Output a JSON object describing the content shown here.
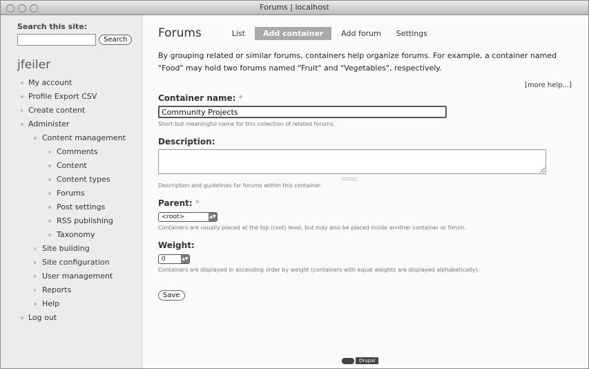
{
  "window": {
    "title": "Forums | localhost"
  },
  "sidebar": {
    "search_label": "Search this site:",
    "search_value": "",
    "search_button": "Search",
    "username": "jfeiler",
    "nav": [
      {
        "label": "My account",
        "level": 0,
        "collapsed": false
      },
      {
        "label": "Profile Export CSV",
        "level": 0,
        "collapsed": false
      },
      {
        "label": "Create content",
        "level": 0,
        "collapsed": true
      },
      {
        "label": "Administer",
        "level": 0,
        "collapsed": false
      },
      {
        "label": "Content management",
        "level": 1,
        "collapsed": false
      },
      {
        "label": "Comments",
        "level": 2,
        "collapsed": false
      },
      {
        "label": "Content",
        "level": 2,
        "collapsed": false
      },
      {
        "label": "Content types",
        "level": 2,
        "collapsed": false
      },
      {
        "label": "Forums",
        "level": 2,
        "collapsed": false
      },
      {
        "label": "Post settings",
        "level": 2,
        "collapsed": false
      },
      {
        "label": "RSS publishing",
        "level": 2,
        "collapsed": false
      },
      {
        "label": "Taxonomy",
        "level": 2,
        "collapsed": false
      },
      {
        "label": "Site building",
        "level": 1,
        "collapsed": true
      },
      {
        "label": "Site configuration",
        "level": 1,
        "collapsed": true
      },
      {
        "label": "User management",
        "level": 1,
        "collapsed": true
      },
      {
        "label": "Reports",
        "level": 1,
        "collapsed": true
      },
      {
        "label": "Help",
        "level": 1,
        "collapsed": false
      },
      {
        "label": "Log out",
        "level": 0,
        "collapsed": false
      }
    ]
  },
  "main": {
    "title": "Forums",
    "tabs": [
      {
        "label": "List",
        "active": false
      },
      {
        "label": "Add container",
        "active": true
      },
      {
        "label": "Add forum",
        "active": false
      },
      {
        "label": "Settings",
        "active": false
      }
    ],
    "intro": "By grouping related or similar forums, containers help organize forums. For example, a container named \"Food\" may hold two forums named \"Fruit\" and \"Vegetables\", respectively.",
    "more_help": "[more help...]",
    "container_name": {
      "label": "Container name:",
      "required_mark": "*",
      "value": "Community Projects",
      "description": "Short but meaningful name for this collection of related forums."
    },
    "description_field": {
      "label": "Description:",
      "value": "",
      "description": "Description and guidelines for forums within this container."
    },
    "parent": {
      "label": "Parent:",
      "required_mark": "*",
      "value": "<root>",
      "description": "Containers are usually placed at the top (root) level, but may also be placed inside another container or forum."
    },
    "weight": {
      "label": "Weight:",
      "value": "0",
      "description": "Containers are displayed in ascending order by weight (containers with equal weights are displayed alphabetically)."
    },
    "save_button": "Save",
    "footer_badge": "Drupal"
  },
  "icons": {
    "window_controls": "traffic-light-icons",
    "footer": "drupal-logo-icon"
  }
}
